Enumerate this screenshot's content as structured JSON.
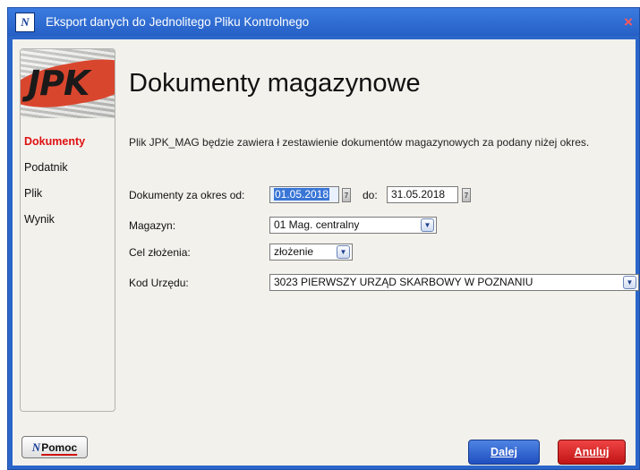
{
  "window": {
    "title": "Eksport danych do Jednolitego Pliku Kontrolnego",
    "icon": "app-logo-icon",
    "close_glyph": "×"
  },
  "logo": {
    "text": "JPK"
  },
  "sidebar": {
    "items": [
      {
        "label": "Dokumenty",
        "active": true
      },
      {
        "label": "Podatnik",
        "active": false
      },
      {
        "label": "Plik",
        "active": false
      },
      {
        "label": "Wynik",
        "active": false
      }
    ]
  },
  "main": {
    "heading": "Dokumenty magazynowe",
    "description": "Plik JPK_MAG będzie zawiera ł zestawienie dokumentów magazynowych za podany niżej okres."
  },
  "form": {
    "period_label": "Dokumenty za okres od:",
    "date_from": "01.05.2018",
    "date_to_label": "do:",
    "date_to": "31.05.2018",
    "warehouse_label": "Magazyn:",
    "warehouse_value": "01 Mag. centralny",
    "purpose_label": "Cel złożenia:",
    "purpose_value": "złożenie",
    "office_label": "Kod Urzędu:",
    "office_value": "3023 PIERWSZY URZĄD SKARBOWY W POZNANIU"
  },
  "footer": {
    "help_icon_text": "N",
    "help_label": "Pomoc",
    "next_label": "Dalej",
    "cancel_label": "Anuluj"
  },
  "colors": {
    "title_bar": "#2b66c9",
    "active_nav": "#e01010",
    "next_button": "#1f4fc0",
    "cancel_button": "#c11414"
  }
}
